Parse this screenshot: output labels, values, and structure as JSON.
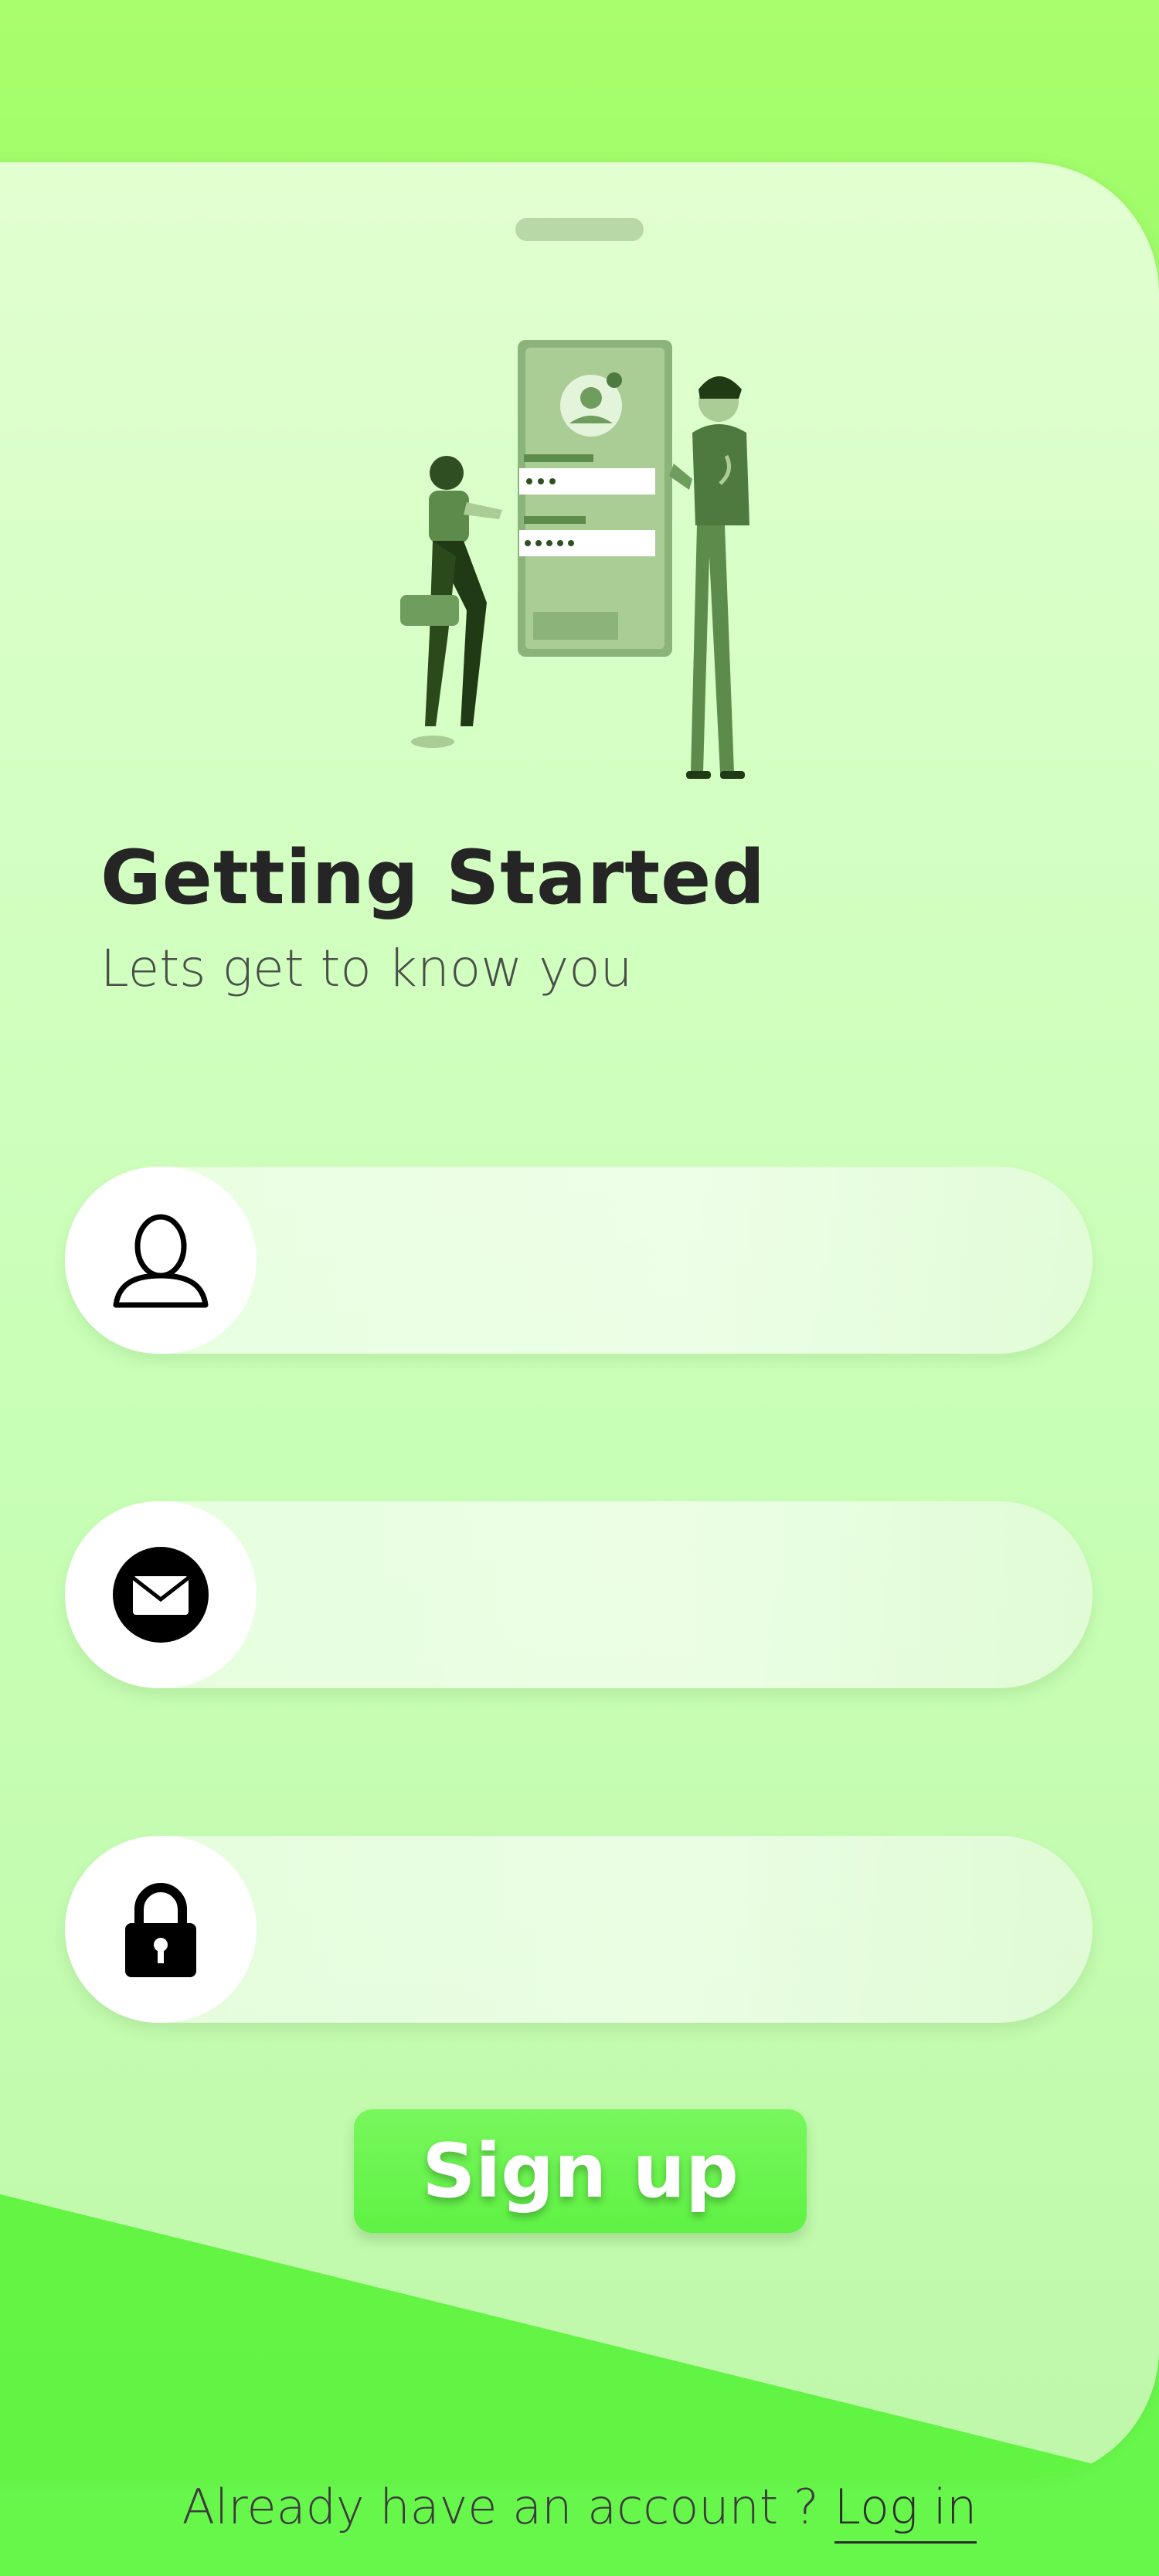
{
  "header": {
    "title": "Getting Started",
    "subtitle": "Lets get to know you"
  },
  "form": {
    "name_field": {
      "icon": "user-icon",
      "value": "",
      "placeholder": ""
    },
    "email_field": {
      "icon": "mail-icon",
      "value": "",
      "placeholder": ""
    },
    "password_field": {
      "icon": "lock-icon",
      "value": "",
      "placeholder": ""
    }
  },
  "actions": {
    "signup_label": "Sign up"
  },
  "footer": {
    "prompt": "Already have an account ?",
    "login_label": "Log in"
  },
  "colors": {
    "background": "#8ef56a",
    "sheet": "#d8ffc7",
    "accent": "#66f74a",
    "title_text": "#252525"
  }
}
